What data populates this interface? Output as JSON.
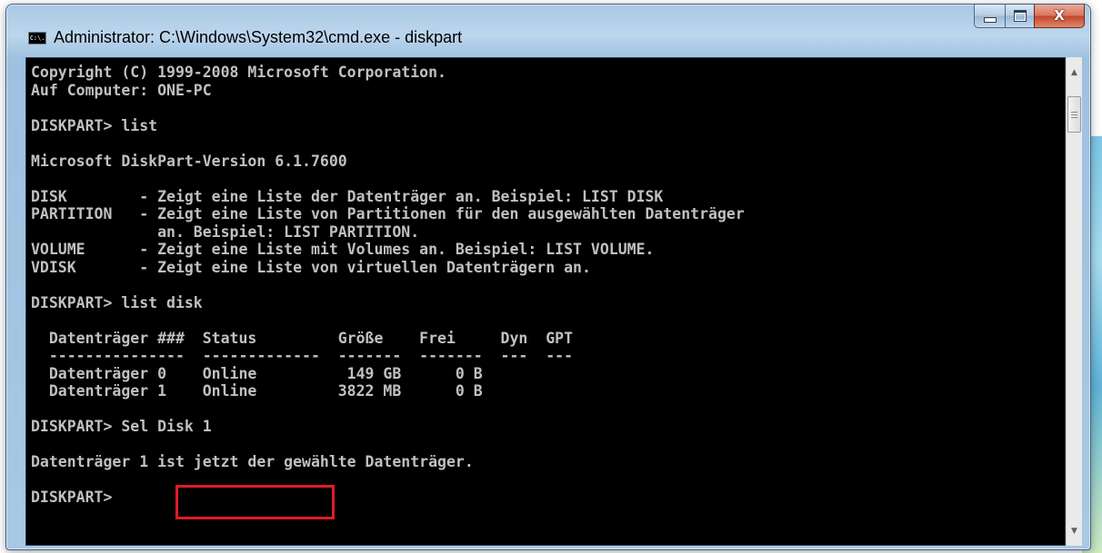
{
  "window": {
    "title": "Administrator: C:\\Windows\\System32\\cmd.exe - diskpart",
    "icon_label": "C:\\."
  },
  "icons": {
    "app": "cmd-console-icon",
    "minimize": "minimize-icon",
    "maximize": "maximize-icon",
    "close": "close-icon",
    "scroll_up": "arrow-up-icon",
    "scroll_down": "arrow-down-icon"
  },
  "colors": {
    "console_bg": "#000000",
    "console_text": "#c0c0c0",
    "highlight": "#e01b24"
  },
  "caption": {
    "close_glyph": "X"
  },
  "console": {
    "lines": [
      "Copyright (C) 1999-2008 Microsoft Corporation.",
      "Auf Computer: ONE-PC",
      "",
      "DISKPART> list",
      "",
      "Microsoft DiskPart-Version 6.1.7600",
      "",
      "DISK        - Zeigt eine Liste der Datenträger an. Beispiel: LIST DISK",
      "PARTITION   - Zeigt eine Liste von Partitionen für den ausgewählten Datenträger",
      "              an. Beispiel: LIST PARTITION.",
      "VOLUME      - Zeigt eine Liste mit Volumes an. Beispiel: LIST VOLUME.",
      "VDISK       - Zeigt eine Liste von virtuellen Datenträgern an.",
      "",
      "DISKPART> list disk",
      "",
      "  Datenträger ###  Status         Größe    Frei     Dyn  GPT",
      "  ---------------  -------------  -------  -------  ---  ---",
      "  Datenträger 0    Online          149 GB      0 B",
      "  Datenträger 1    Online         3822 MB      0 B",
      "",
      "DISKPART> Sel Disk 1",
      "",
      "Datenträger 1 ist jetzt der gewählte Datenträger.",
      "",
      "DISKPART>"
    ]
  }
}
